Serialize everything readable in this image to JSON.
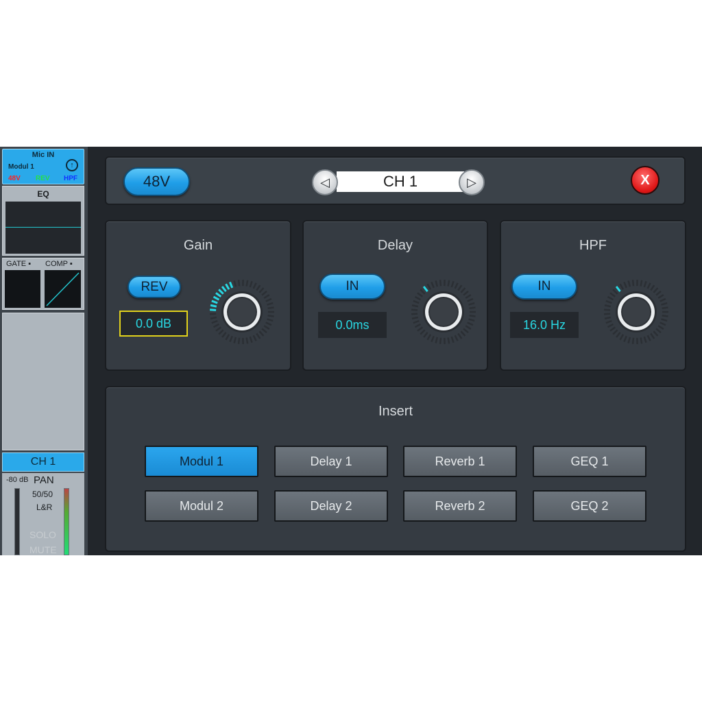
{
  "strip": {
    "mic_in": "Mic IN",
    "module": "Modul 1",
    "flag_48v": "48V",
    "flag_rev": "REV",
    "flag_hpf": "HPF",
    "eq_label": "EQ",
    "gate_label": "GATE ▪",
    "comp_label": "COMP ▪",
    "channel": "CH 1",
    "level": "-80 dB",
    "pan_label": "PAN",
    "pan_value": "50/50",
    "pan_mode": "L&R",
    "solo": "SOLO",
    "mute": "MUTE"
  },
  "header": {
    "phantom_48v": "48V",
    "channel": "CH 1",
    "prev_icon": "◁",
    "next_icon": "▷",
    "close_icon": "X"
  },
  "gain": {
    "title": "Gain",
    "rev_label": "REV",
    "value": "0.0 dB"
  },
  "delay": {
    "title": "Delay",
    "in_label": "IN",
    "value": "0.0ms"
  },
  "hpf": {
    "title": "HPF",
    "in_label": "IN",
    "value": "16.0 Hz"
  },
  "insert": {
    "title": "Insert",
    "row1": [
      "Modul 1",
      "Delay 1",
      "Reverb 1",
      "GEQ 1"
    ],
    "row2": [
      "Modul 2",
      "Delay 2",
      "Reverb 2",
      "GEQ 2"
    ],
    "active": "Modul 1"
  },
  "colors": {
    "accent": "#2aa9ea",
    "value_text": "#29d8e3",
    "close": "#e01818",
    "gain_value_border": "#e2d21c"
  }
}
